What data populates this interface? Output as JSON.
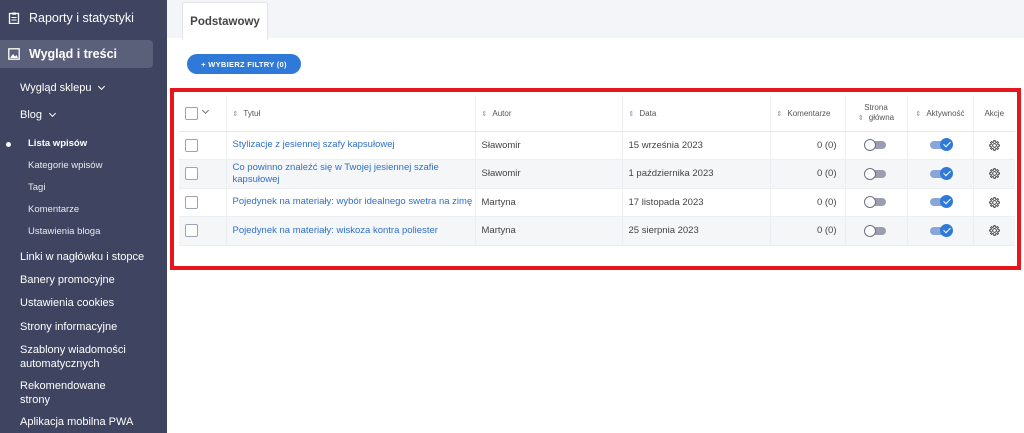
{
  "sidebar": {
    "reports_label": "Raporty i statystyki",
    "appearance_label": "Wygląd i treści",
    "items": {
      "shop_appearance": "Wygląd sklepu",
      "blog": "Blog",
      "posts_list": "Lista wpisów",
      "post_categories": "Kategorie wpisów",
      "tags": "Tagi",
      "comments": "Komentarze",
      "blog_settings": "Ustawienia bloga",
      "header_footer_links": "Linki w nagłówku i stopce",
      "promo_banners": "Banery promocyjne",
      "cookie_settings": "Ustawienia cookies",
      "info_pages_1": "Strony informacyjne",
      "templates_line1": "Szablony wiadomości",
      "templates_line2": "automatycznych",
      "recommended_line1": "Rekomendowane",
      "recommended_line2": "strony",
      "pwa_app": "Aplikacja mobilna PWA"
    }
  },
  "tabs": {
    "basic": "Podstawowy"
  },
  "filter_button": "+ WYBIERZ FILTRY (0)",
  "table": {
    "headers": {
      "title": "Tytuł",
      "author": "Autor",
      "date": "Data",
      "comments": "Komentarze",
      "homepage_line1": "Strona",
      "homepage_line2": "główna",
      "active": "Aktywność",
      "actions": "Akcje"
    },
    "rows": [
      {
        "title": "Stylizacje z jesiennej szafy kapsułowej",
        "author": "Sławomir",
        "date": "15 września 2023",
        "comments": "0 (0)",
        "homepage": false,
        "active": true
      },
      {
        "title": "Co powinno znaleźć się w Twojej jesiennej szafie kapsułowej",
        "author": "Sławomir",
        "date": "1 października 2023",
        "comments": "0 (0)",
        "homepage": false,
        "active": true
      },
      {
        "title": "Pojedynek na materiały: wybór idealnego swetra na zimę",
        "author": "Martyna",
        "date": "17 listopada 2023",
        "comments": "0 (0)",
        "homepage": false,
        "active": true
      },
      {
        "title": "Pojedynek na materiały: wiskoza kontra poliester",
        "author": "Martyna",
        "date": "25 sierpnia 2023",
        "comments": "0 (0)",
        "homepage": false,
        "active": true
      }
    ]
  },
  "colors": {
    "sidebar_bg": "#3f4560",
    "accent": "#2f7ad8",
    "highlight_frame": "#e6161c"
  }
}
